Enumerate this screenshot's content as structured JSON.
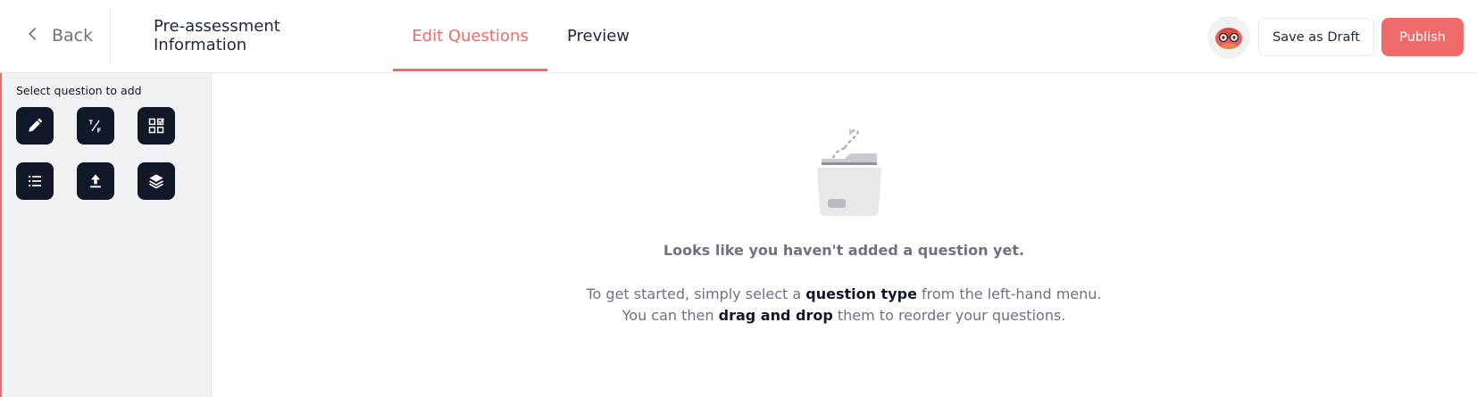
{
  "header": {
    "back_label": "Back",
    "tabs": [
      {
        "label": "Pre-assessment Information",
        "active": false
      },
      {
        "label": "Edit Questions",
        "active": true
      },
      {
        "label": "Preview",
        "active": false
      }
    ],
    "save_draft_label": "Save as Draft",
    "publish_label": "Publish"
  },
  "sidebar": {
    "title": "Select question to add",
    "question_types": [
      {
        "icon": "pencil-icon"
      },
      {
        "icon": "true-false-icon"
      },
      {
        "icon": "grid-check-icon"
      },
      {
        "icon": "list-icon"
      },
      {
        "icon": "upload-icon"
      },
      {
        "icon": "layers-icon"
      }
    ]
  },
  "empty_state": {
    "heading": "Looks like you haven't added a question yet.",
    "line1_before": "To get started, simply select a ",
    "line1_bold": "question type",
    "line1_after": " from the left-hand menu.",
    "line2_before": "You can then ",
    "line2_bold": "drag and drop",
    "line2_after": " them to reorder your questions."
  },
  "colors": {
    "accent": "#ef6b6b",
    "sidebar_bg": "#f1f2f4",
    "icon_button_bg": "#111827",
    "muted_text": "#6b7280"
  }
}
